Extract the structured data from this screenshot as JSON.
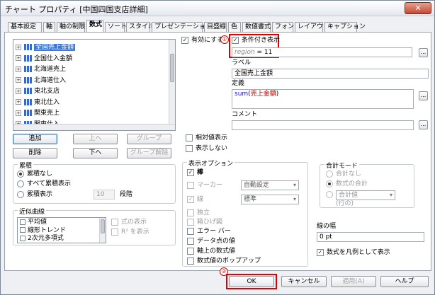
{
  "window": {
    "title": "チャート プロパティ [中国四国支店詳細]",
    "close_glyph": "✕"
  },
  "tabs": [
    "基本設定",
    "軸",
    "軸の制限",
    "数式",
    "ソート",
    "スタイル",
    "プレゼンテーション",
    "目盛線",
    "色",
    "数値書式",
    "フォント",
    "レイアウト",
    "キャプション"
  ],
  "selected_tab": "数式",
  "expressions": [
    {
      "label": "全国売上金額",
      "selected": true
    },
    {
      "label": "全国仕入金額",
      "selected": false
    },
    {
      "label": "北海道売上",
      "selected": false
    },
    {
      "label": "北海道仕入",
      "selected": false
    },
    {
      "label": "東北支店",
      "selected": false
    },
    {
      "label": "東北仕入",
      "selected": false
    },
    {
      "label": "関東売上",
      "selected": false
    },
    {
      "label": "関東仕入",
      "selected": false
    }
  ],
  "expr_buttons": {
    "add": "追加",
    "up": "上へ",
    "group": "グループ",
    "delete": "削除",
    "down": "下へ",
    "ungroup": "グループ解除"
  },
  "accumulation": {
    "title": "累積",
    "none": "累積なし",
    "all": "すべて累積表示",
    "show": "累積表示",
    "steps_value": "10",
    "steps_label": "段階"
  },
  "trendlines": {
    "title": "近似曲線",
    "items": [
      "平均値",
      "線形トレンド",
      "2次元多項式"
    ],
    "show_formula": "式の表示",
    "show_r2": "R² を表示"
  },
  "enable": {
    "label": "有効にする"
  },
  "conditional": {
    "label": "条件付き表示",
    "formula_var": "region",
    "formula_rest": " = 11"
  },
  "label_field": {
    "title": "ラベル",
    "value": "全国売上金額"
  },
  "definition": {
    "title": "定義",
    "func": "sum",
    "arg": "売上金額"
  },
  "comment": {
    "title": "コメント",
    "value": ""
  },
  "relative": "相対値表示",
  "invisible": "表示しない",
  "display_options": {
    "title": "表示オプション",
    "bar": "棒",
    "marker": "マーカー",
    "marker_value": "自動設定",
    "line": "線",
    "line_value": "標準",
    "values_on_data": "独立",
    "box_plot": "箱ひげ図",
    "error_bars": "エラー バー",
    "data_values": "データ点の値",
    "axis_values": "軸上の数式値",
    "popup": "数式値のポップアップ"
  },
  "total_mode": {
    "title": "合計モード",
    "none": "合計なし",
    "expr_total": "数式の合計",
    "agg_value": "合計値",
    "agg_sub": "(行の)"
  },
  "line_width": {
    "title": "線の幅",
    "value": "0 pt"
  },
  "legend_expr": "数式を凡例として表示",
  "footer": {
    "ok": "OK",
    "cancel": "キャンセル",
    "apply": "適用(A)",
    "help": "ヘルプ"
  },
  "annotations": {
    "one": "①",
    "two": "②"
  }
}
